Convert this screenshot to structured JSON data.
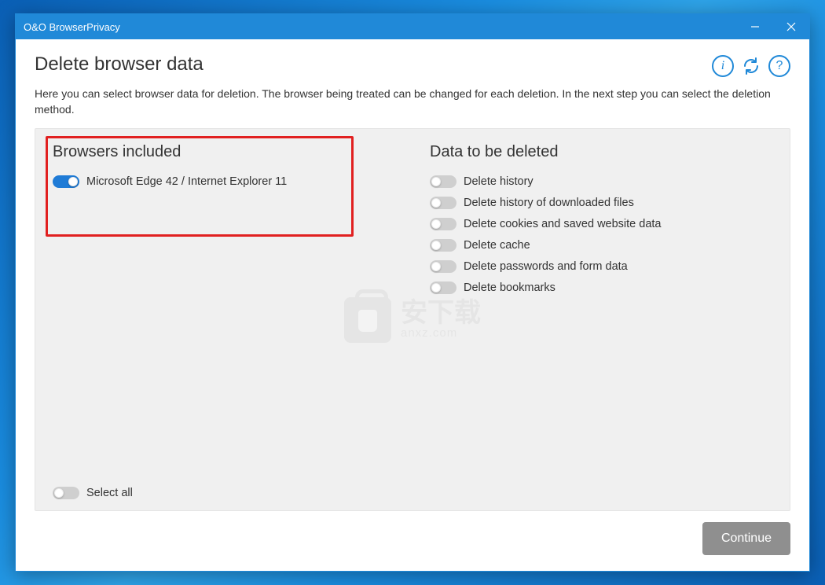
{
  "window": {
    "title": "O&O BrowserPrivacy"
  },
  "header": {
    "title": "Delete browser data",
    "description": "Here you can select browser data for deletion. The browser being treated can be changed for each deletion. In the next step you can select the deletion method."
  },
  "browsers": {
    "section_title": "Browsers included",
    "items": [
      {
        "label": "Microsoft Edge 42 / Internet Explorer 11",
        "on": true
      }
    ]
  },
  "data_to_delete": {
    "section_title": "Data to be deleted",
    "items": [
      {
        "label": "Delete history",
        "on": false
      },
      {
        "label": "Delete history of downloaded files",
        "on": false
      },
      {
        "label": "Delete cookies and saved website data",
        "on": false
      },
      {
        "label": "Delete cache",
        "on": false
      },
      {
        "label": "Delete passwords and form data",
        "on": false
      },
      {
        "label": "Delete bookmarks",
        "on": false
      }
    ]
  },
  "select_all": {
    "label": "Select all",
    "on": false
  },
  "actions": {
    "continue": "Continue"
  },
  "watermark": {
    "cn": "安下载",
    "en": "anxz.com"
  }
}
